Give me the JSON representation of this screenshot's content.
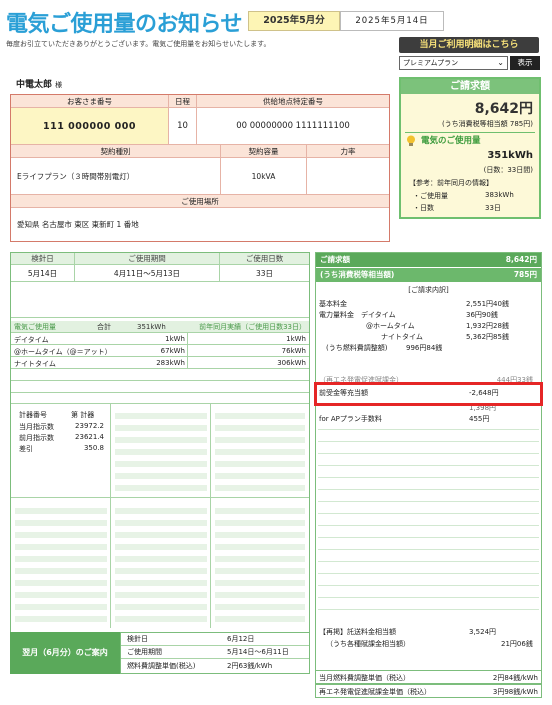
{
  "header": {
    "title": "電気ご使用量のお知らせ",
    "month": "2025年5月分",
    "date": "2025年5月14日",
    "greeting": "毎度お引立ていただきありがとうございます。電気ご使用量をお知らせいたします。"
  },
  "controls": {
    "detail_button": "当月ご利用明細はこちら",
    "plan_select": "プレミアムプラン",
    "show_button": "表示"
  },
  "customer": {
    "name": "中電太郎",
    "honorific": "様",
    "number_label": "お客さま番号",
    "number": "111 000000 000",
    "day_label": "日程",
    "day": "10",
    "supply_label": "供給地点特定番号",
    "supply": "00 00000000 1111111100",
    "contract_type_label": "契約種別",
    "contract_type": "Eライフプラン（３時間帯別電灯）",
    "capacity_label": "契約容量",
    "capacity": "10kVA",
    "power_factor_label": "力率",
    "place_label": "ご使用場所",
    "place": "愛知県 名古屋市 東区 東新町 1 番地"
  },
  "bill": {
    "header": "ご請求額",
    "amount": "8,642円",
    "tax_note": "(うち消費税等相当額 785円)",
    "usage_title": "電気のご使用量",
    "usage_kwh": "351kWh",
    "usage_days": "(日数：33日間)",
    "ref_title": "【参考：前年同月の情報】",
    "ref_usage_label": "・ご使用量",
    "ref_usage": "383kWh",
    "ref_days_label": "・日数",
    "ref_days": "33日"
  },
  "meter": {
    "inspect_label": "検針日",
    "inspect": "5月14日",
    "period_label": "ご使用期間",
    "period": "4月11日～5月13日",
    "days_label": "ご使用日数",
    "days": "33日"
  },
  "usage": {
    "title": "電気ご使用量",
    "total_label": "合計",
    "total": "351kWh",
    "prev_label": "前年同月実績（ご使用日数33日）",
    "rows": [
      {
        "label": "デイタイム",
        "value": "1kWh",
        "prev": "1kWh"
      },
      {
        "label": "@ホームタイム（@＝アット）",
        "value": "67kWh",
        "prev": "76kWh"
      },
      {
        "label": "ナイトタイム",
        "value": "283kWh",
        "prev": "306kWh"
      }
    ]
  },
  "meter_reading": {
    "meter_no_label": "計器番号",
    "meter_no": "第 計器",
    "rows": [
      {
        "label": "当月指示数",
        "value": "23972.2"
      },
      {
        "label": "前月指示数",
        "value": "23621.4"
      },
      {
        "label": "差引",
        "value": "350.8"
      }
    ]
  },
  "charges": {
    "total_label": "ご請求額",
    "total": "8,642円",
    "tax_label": "(うち消費税等相当額)",
    "tax": "785円",
    "detail_title": "[ご請求内訳]",
    "lines": [
      {
        "label": "基本料金",
        "value": "2,551円40銭"
      },
      {
        "label": "電力量料金　デイタイム",
        "value": "36円90銭"
      },
      {
        "label": "@ホームタイム",
        "value": "1,932円28銭"
      },
      {
        "label": "ナイトタイム",
        "value": "5,362円85銭"
      },
      {
        "label": "(うち燃料費調整額)",
        "value": "996円84銭"
      }
    ],
    "partial_label": "（再エネ発電促進賦課金）",
    "partial_value": "444円33銭",
    "highlight_label": "前受金等充当額",
    "highlight_value": "-2,648円",
    "hidden_value": "1,398円",
    "fee_label": "for APプラン手数料",
    "fee_value": "455円",
    "consign_label": "【再掲】託送料金相当額",
    "consign_value": "3,524円",
    "consign_tax_label": "（うち各種賦課金相当額）",
    "consign_tax_value": "21円06銭"
  },
  "next_month": {
    "label": "翌月（6月分）のご案内",
    "inspect_label": "検針日",
    "inspect": "6月12日",
    "period_label": "ご使用期間",
    "period": "5月14日～6月11日",
    "fuel_label": "燃料費調整単価(税込)",
    "fuel": "2円63銭/kWh"
  },
  "unit_prices": [
    {
      "label": "当月燃料費調整単価（税込）",
      "value": "2円84銭/kWh"
    },
    {
      "label": "再エネ発電促進賦課金単価（税込）",
      "value": "3円98銭/kWh"
    }
  ]
}
